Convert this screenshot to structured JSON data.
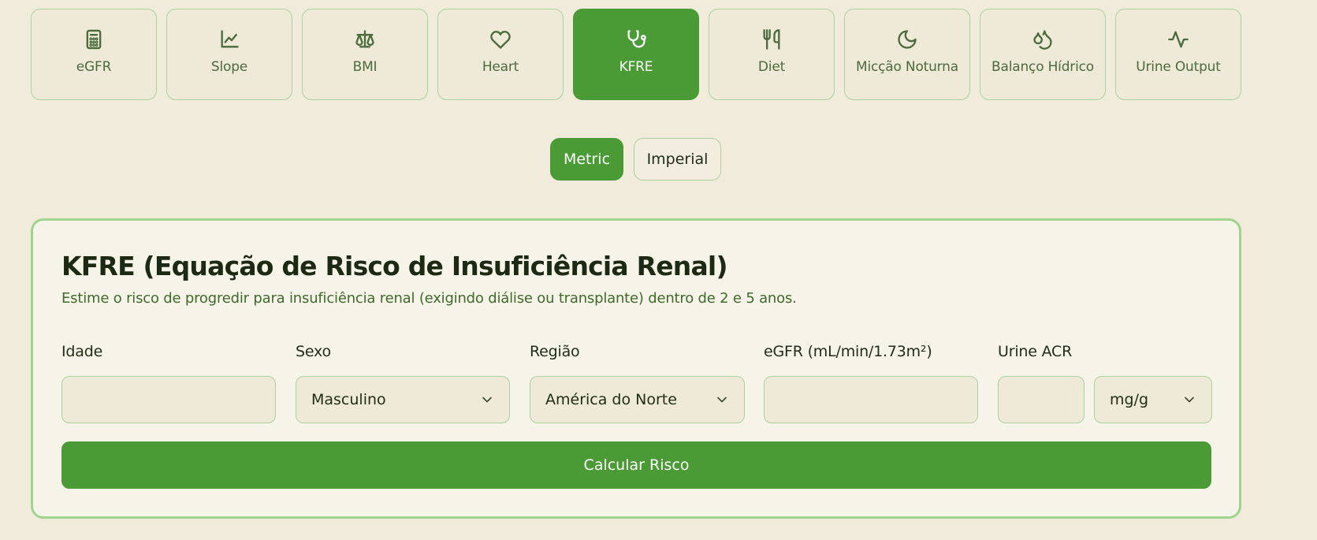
{
  "tools": [
    {
      "label": "eGFR",
      "icon": "calculator-icon"
    },
    {
      "label": "Slope",
      "icon": "line-chart-icon"
    },
    {
      "label": "BMI",
      "icon": "scale-icon"
    },
    {
      "label": "Heart",
      "icon": "heart-icon"
    },
    {
      "label": "KFRE",
      "icon": "stethoscope-icon",
      "active": true
    },
    {
      "label": "Diet",
      "icon": "utensils-icon"
    },
    {
      "label": "Micção Noturna",
      "icon": "moon-icon"
    },
    {
      "label": "Balanço Hídrico",
      "icon": "droplets-icon"
    },
    {
      "label": "Urine Output",
      "icon": "activity-icon"
    }
  ],
  "units": {
    "metric": "Metric",
    "imperial": "Imperial",
    "selected": "Metric"
  },
  "card": {
    "title": "KFRE (Equação de Risco de Insuficiência Renal)",
    "subtitle": "Estime o risco de progredir para insuficiência renal (exigindo diálise ou transplante) dentro de 2 e 5 anos.",
    "fields": {
      "age_label": "Idade",
      "age_value": "",
      "sex_label": "Sexo",
      "sex_value": "Masculino",
      "region_label": "Região",
      "region_value": "América do Norte",
      "egfr_label": "eGFR (mL/min/1.73m²)",
      "egfr_value": "",
      "acr_label": "Urine ACR",
      "acr_value": "",
      "acr_unit": "mg/g"
    },
    "calculate_label": "Calcular Risco"
  },
  "colors": {
    "background": "#f0ebda",
    "accent": "#4a9a35",
    "border": "#a9d39a",
    "subtitle": "#3f6a2b"
  }
}
